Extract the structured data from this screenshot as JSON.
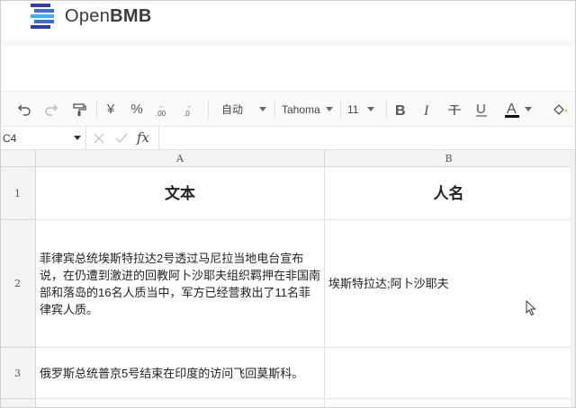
{
  "app": {
    "brand_regular": "Open",
    "brand_bold": "BMB",
    "accent_color": "#3a6fd8"
  },
  "toolbar": {
    "undo_icon": "undo-icon",
    "redo_icon": "redo-icon",
    "format_painter_icon": "paint-format-icon",
    "currency_label": "¥",
    "percent_label": "%",
    "decimal_increase_icon": "decimal-increase-icon",
    "decimal_decrease_icon": "decimal-decrease-icon",
    "number_format": "自动",
    "font_family": "Tahoma",
    "font_size": "11",
    "bold_icon": "bold-icon",
    "italic_icon": "italic-icon",
    "strikethrough_icon": "strikethrough-icon",
    "underline_icon": "underline-icon",
    "text_color_icon": "text-color-icon",
    "fill_color_icon": "fill-color-icon"
  },
  "formula_bar": {
    "cell_ref": "C4",
    "fx_label": "fx",
    "value": ""
  },
  "sheet": {
    "columns": [
      "A",
      "B"
    ],
    "rows": [
      {
        "num": "1",
        "cells": [
          "文本",
          "人名"
        ]
      },
      {
        "num": "2",
        "cells": [
          "菲律宾总统埃斯特拉达2号透过马尼拉当地电台宣布说，在仍遭到激进的回教阿卜沙耶夫组织羁押在非国南部和落岛的16名人质当中，军方已经营救出了11名菲律宾人质。",
          "埃斯特拉达;阿卜沙耶夫"
        ]
      },
      {
        "num": "3",
        "cells": [
          "俄罗斯总统普京5号结束在印度的访问飞回莫斯科。",
          ""
        ]
      }
    ]
  }
}
